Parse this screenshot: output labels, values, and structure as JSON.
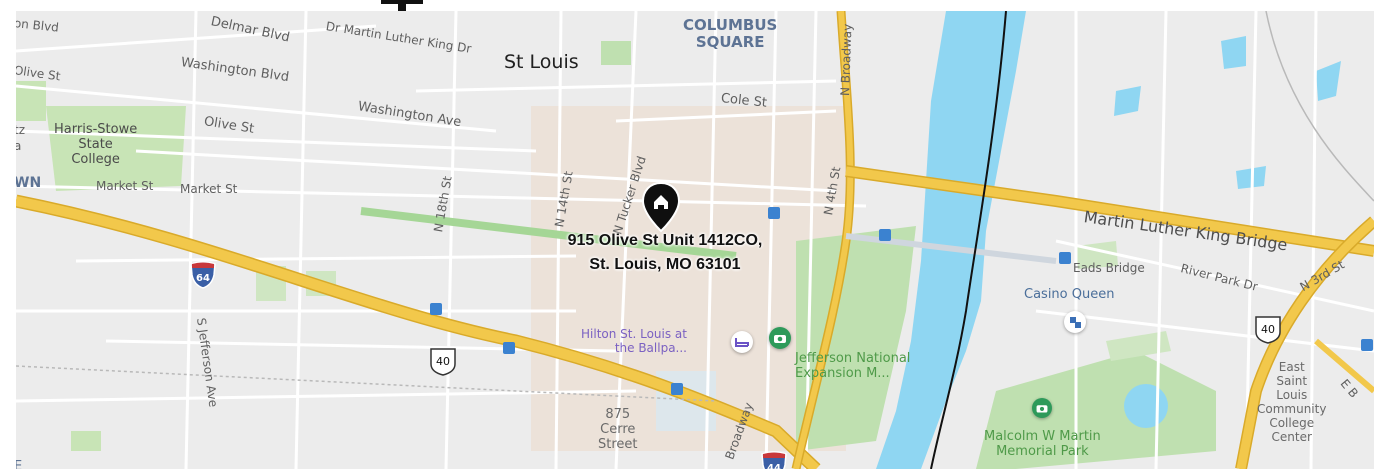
{
  "map": {
    "pin": {
      "address_line1": "915 Olive St Unit 1412CO,",
      "address_line2": "St. Louis, MO 63101",
      "icon": "home-pin-icon"
    },
    "city_label": "St Louis",
    "district_label": [
      "COLUMBUS",
      "SQUARE"
    ],
    "streets": {
      "delmar": "Delmar Blvd",
      "mlk_dr": "Dr Martin Luther King Dr",
      "washington_blvd": "Washington Blvd",
      "washington_ave": "Washington Ave",
      "olive_w": "Olive St",
      "olive_e": "Olive St",
      "cole": "Cole St",
      "market_1": "Market St",
      "market_2": "Market St",
      "n18th": "N 18th St",
      "n14th": "N 14th St",
      "tucker": "N Tucker Blvd",
      "n4th": "N 4th St",
      "broadway_n": "N Broadway",
      "broadway_s": "Broadway",
      "jefferson": "S Jefferson Ave",
      "eads": "Eads Bridge",
      "river_park": "River Park Dr",
      "n3rd": "N 3rd St",
      "e_b": "E B",
      "on_blvd": "on Blvd",
      "ive_st": "Olive St",
      "tz": "tz",
      "a": "a",
      "wn": "WN",
      "e_edge": "E"
    },
    "bridge_label": "Martin Luther King Bridge",
    "places": {
      "harris": [
        "Harris-Stowe",
        "State",
        "College"
      ],
      "casino": "Casino Queen",
      "hilton": [
        "Hilton St. Louis at",
        "the Ballpa..."
      ],
      "jefferson_park": [
        "Jefferson National",
        "Expansion M..."
      ],
      "malcolm": [
        "Malcolm W Martin",
        "Memorial Park"
      ],
      "cerre": [
        "875",
        "Cerre",
        "Street"
      ],
      "east_college": [
        "East",
        "Saint",
        "Louis",
        "Community",
        "College",
        "Center"
      ]
    },
    "shields": {
      "i64": "64",
      "us40_west": "40",
      "us40_east": "40",
      "i44": "44"
    },
    "colors": {
      "land": "#ececec",
      "water": "#8fd6f2",
      "park": "#bfe0b0",
      "downtown": "#ecdcd0",
      "highway": "#f2c84b",
      "highway_edge": "#d9aa2a",
      "road": "#ffffff"
    }
  }
}
